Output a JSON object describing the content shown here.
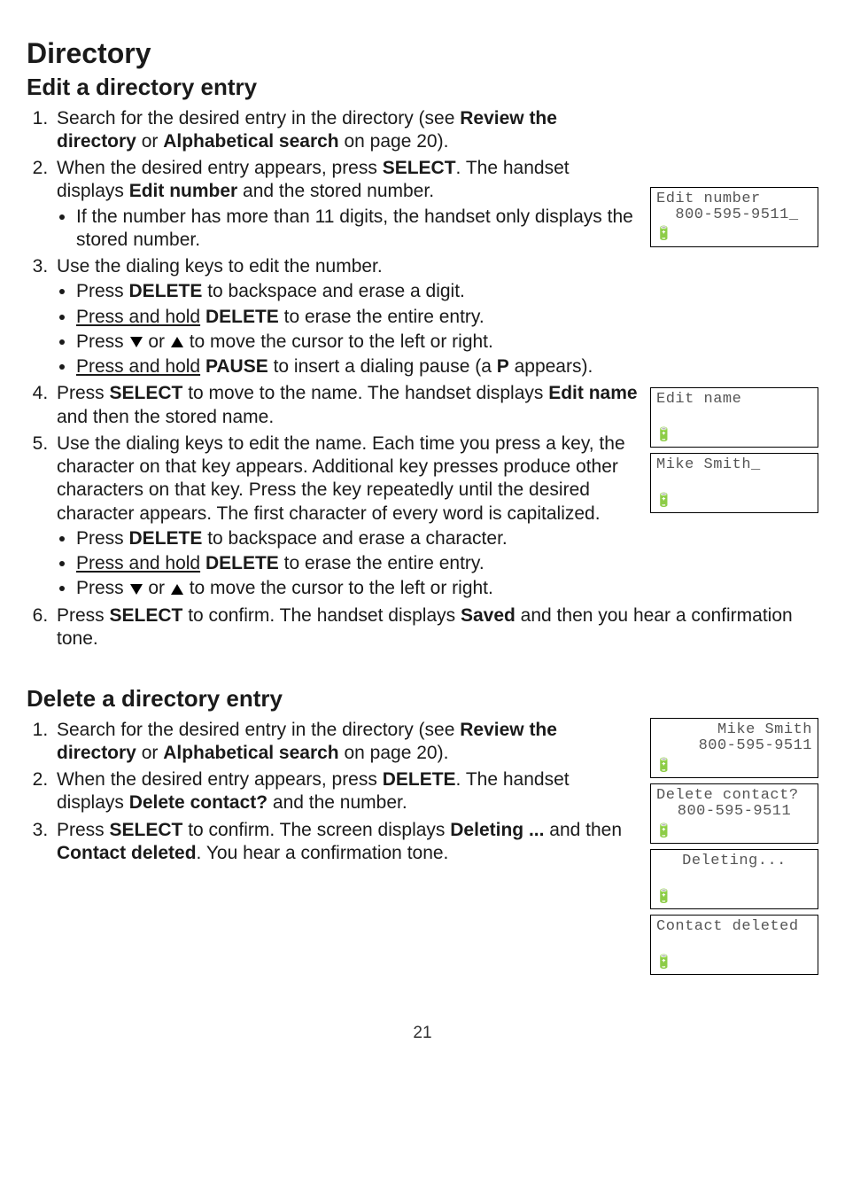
{
  "title": "Directory",
  "section_edit_title": "Edit a directory entry",
  "section_delete_title": "Delete a directory entry",
  "step1_a": "Search for the desired entry in the directory (see ",
  "step1_b": "Review the directory",
  "step1_c": " or ",
  "step1_d": "Alphabetical search",
  "step1_e": " on page 20).",
  "step2_a": "When the desired entry appears, press ",
  "step2_b": "SELECT",
  "step2_c": ". The handset displays ",
  "step2_d": "Edit number",
  "step2_e": " and the stored number.",
  "step2_sub_a": "If the number has more than 11 digits, the handset only displays the stored number.",
  "step3_a": "Use the dialing keys to edit the number.",
  "step3_sub1_a": "Press ",
  "step3_sub1_b": "DELETE",
  "step3_sub1_c": " to backspace and erase a digit.",
  "step3_sub2_a": "Press and hold",
  "step3_sub2_b": " ",
  "step3_sub2_c": "DELETE",
  "step3_sub2_d": " to erase the entire entry.",
  "step3_sub3_a": "Press ",
  "step3_sub3_b": " or ",
  "step3_sub3_c": " to move the cursor to the left or right.",
  "step3_sub4_a": "Press and hold",
  "step3_sub4_b": " ",
  "step3_sub4_c": "PAUSE",
  "step3_sub4_d": " to insert a dialing pause (a ",
  "step3_sub4_e": "P",
  "step3_sub4_f": " appears).",
  "step4_a": "Press ",
  "step4_b": "SELECT",
  "step4_c": " to move to the name. The handset displays ",
  "step4_d": "Edit name",
  "step4_e": " and then the stored name.",
  "step5_a": "Use the dialing keys to edit the name. Each time you press a key, the character on that key appears. Additional key presses produce other characters on that key. Press the key repeatedly until the desired character appears. The first character of every word is capitalized.",
  "step5_sub1_a": "Press ",
  "step5_sub1_b": "DELETE",
  "step5_sub1_c": " to backspace and erase a character.",
  "step5_sub2_a": "Press and hold",
  "step5_sub2_b": " ",
  "step5_sub2_c": "DELETE",
  "step5_sub2_d": " to erase the entire entry.",
  "step5_sub3_a": "Press ",
  "step5_sub3_b": " or ",
  "step5_sub3_c": " to move the cursor to the left or right.",
  "step6_a": "Press ",
  "step6_b": "SELECT",
  "step6_c": " to confirm. The handset displays ",
  "step6_d": "Saved",
  "step6_e": " and then you hear a confirmation tone.",
  "dstep1_a": "Search for the desired entry in the directory (see ",
  "dstep1_b": "Review the directory",
  "dstep1_c": " or ",
  "dstep1_d": "Alphabetical search",
  "dstep1_e": " on page 20).",
  "dstep2_a": "When the desired entry appears, press ",
  "dstep2_b": "DELETE",
  "dstep2_c": ". The handset displays ",
  "dstep2_d": "Delete contact?",
  "dstep2_e": " and the number.",
  "dstep3_a": "Press ",
  "dstep3_b": "SELECT",
  "dstep3_c": " to confirm. The screen displays ",
  "dstep3_d": "Deleting ...",
  "dstep3_e": " and then ",
  "dstep3_f": "Contact deleted",
  "dstep3_g": ". You hear a confirmation tone.",
  "lcd1_l1": "Edit number",
  "lcd1_l2": "  800-595-9511_",
  "lcd2_l1": "Edit name",
  "lcd2_l2": "",
  "lcd3_l1": "Mike Smith_",
  "lcd3_l2": "",
  "lcd4_l1": "Mike Smith",
  "lcd4_l2": "800-595-9511",
  "lcd5_l1": "Delete contact?",
  "lcd5_l2": "800-595-9511",
  "lcd6_l1": "Deleting...",
  "lcd6_l2": "",
  "lcd7_l1": "Contact deleted",
  "lcd7_l2": "",
  "batt_icon": "🔋",
  "page_number": "21"
}
